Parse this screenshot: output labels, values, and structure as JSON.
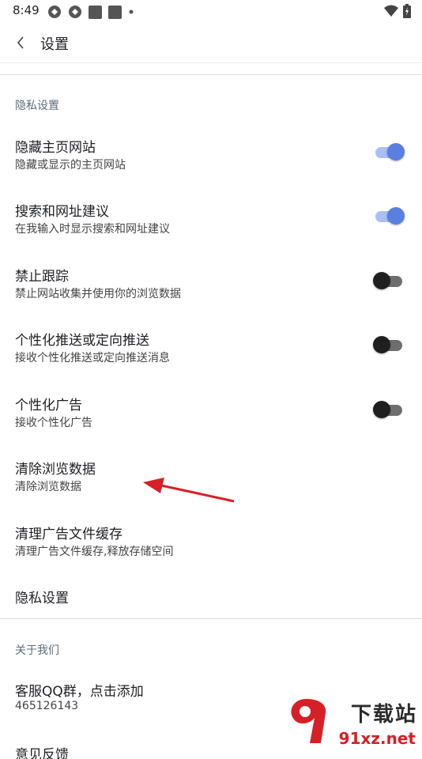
{
  "status_bar": {
    "time": "8:49"
  },
  "app_bar": {
    "title": "设置"
  },
  "sections": [
    {
      "header": "隐私设置"
    },
    {
      "header": "关于我们"
    }
  ],
  "privacy_items": [
    {
      "title": "隐藏主页网站",
      "subtitle": "隐藏或显示的主页网站",
      "toggle": true
    },
    {
      "title": "搜索和网址建议",
      "subtitle": "在我输入时显示搜索和网址建议",
      "toggle": true
    },
    {
      "title": "禁止跟踪",
      "subtitle": "禁止网站收集并使用你的浏览数据",
      "toggle": false
    },
    {
      "title": "个性化推送或定向推送",
      "subtitle": "接收个性化推送或定向推送消息",
      "toggle": false
    },
    {
      "title": "个性化广告",
      "subtitle": "接收个性化广告",
      "toggle": false
    },
    {
      "title": "清除浏览数据",
      "subtitle": "清除浏览数据"
    },
    {
      "title": "清理广告文件缓存",
      "subtitle": "清理广告文件缓存,释放存储空间"
    },
    {
      "title": "隐私设置"
    }
  ],
  "about_items": [
    {
      "title": "客服QQ群，点击添加",
      "subtitle": "465126143"
    },
    {
      "title": "意见反馈"
    }
  ],
  "watermark": {
    "top": "下载站",
    "bottom": "91xz.net"
  },
  "colors": {
    "accent": "#5b7fe0",
    "accent_track": "#a9bff5",
    "arrow": "#d62027"
  }
}
